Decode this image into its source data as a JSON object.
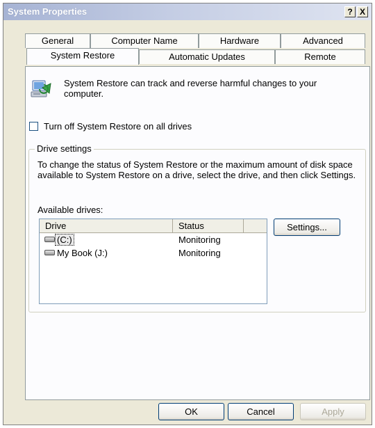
{
  "window": {
    "title": "System Properties",
    "help_glyph": "?",
    "close_glyph": "X"
  },
  "tabs": {
    "row1": [
      "General",
      "Computer Name",
      "Hardware",
      "Advanced"
    ],
    "row2": [
      "System Restore",
      "Automatic Updates",
      "Remote"
    ],
    "active": "System Restore"
  },
  "system_restore": {
    "icon": "system-restore-icon",
    "intro": "System Restore can track and reverse harmful changes to your computer.",
    "turn_off_label": "Turn off System Restore on all drives",
    "turn_off_checked": false,
    "group_title": "Drive settings",
    "group_description": "To change the status of System Restore or the maximum amount of disk space available to System Restore on a drive, select the drive, and then click Settings.",
    "available_drives_label": "Available drives:",
    "columns": [
      "Drive",
      "Status",
      ""
    ],
    "drives": [
      {
        "name": "(C:)",
        "status": "Monitoring",
        "icon": "hard-drive-icon",
        "selected": true
      },
      {
        "name": "My Book (J:)",
        "status": "Monitoring",
        "icon": "hard-drive-icon",
        "selected": false
      }
    ],
    "settings_button": "Settings..."
  },
  "footer": {
    "ok": "OK",
    "cancel": "Cancel",
    "apply": "Apply",
    "apply_enabled": false
  }
}
